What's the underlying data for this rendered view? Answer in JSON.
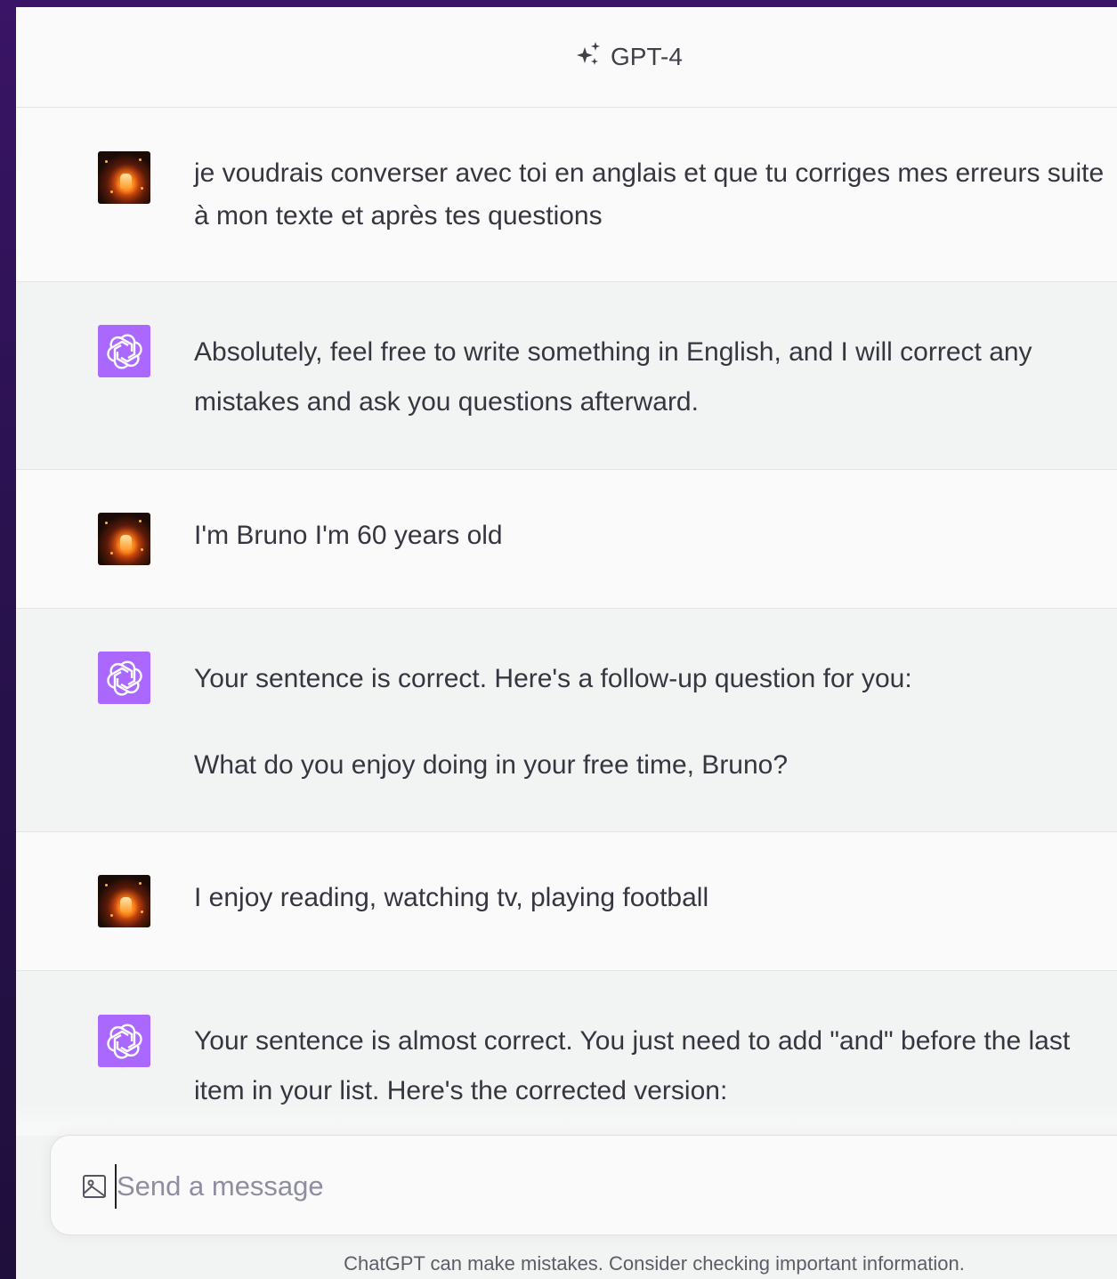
{
  "header": {
    "model_label": "GPT-4",
    "model_icon": "sparkle-icon"
  },
  "messages": [
    {
      "role": "user",
      "avatar": "user-avatar",
      "paragraphs": [
        "je voudrais converser avec toi en anglais et que tu corriges mes erreurs suite à mon texte et après tes questions"
      ]
    },
    {
      "role": "assistant",
      "avatar": "openai-logo-icon",
      "paragraphs": [
        "Absolutely, feel free to write something in English, and I will correct any mistakes and ask you questions afterward."
      ]
    },
    {
      "role": "user",
      "avatar": "user-avatar",
      "paragraphs": [
        "I'm Bruno I'm 60 years old"
      ]
    },
    {
      "role": "assistant",
      "avatar": "openai-logo-icon",
      "paragraphs": [
        "Your sentence is correct. Here's a follow-up question for you:",
        "What do you enjoy doing in your free time, Bruno?"
      ]
    },
    {
      "role": "user",
      "avatar": "user-avatar",
      "paragraphs": [
        "I enjoy reading, watching tv, playing football"
      ]
    },
    {
      "role": "assistant",
      "avatar": "openai-logo-icon",
      "paragraphs": [
        "Your sentence is almost correct. You just need to add \"and\" before the last item in your list. Here's the corrected version:"
      ]
    }
  ],
  "composer": {
    "placeholder": "Send a message",
    "value": "",
    "attach_icon": "image-icon"
  },
  "footer": {
    "disclaimer": "ChatGPT can make mistakes. Consider checking important information."
  },
  "colors": {
    "assistant_avatar_bg": "#ab68ff",
    "assistant_row_bg": "#f2f4f3",
    "user_row_bg": "#fafafa",
    "text": "#363640",
    "backdrop": "#2a1250"
  }
}
